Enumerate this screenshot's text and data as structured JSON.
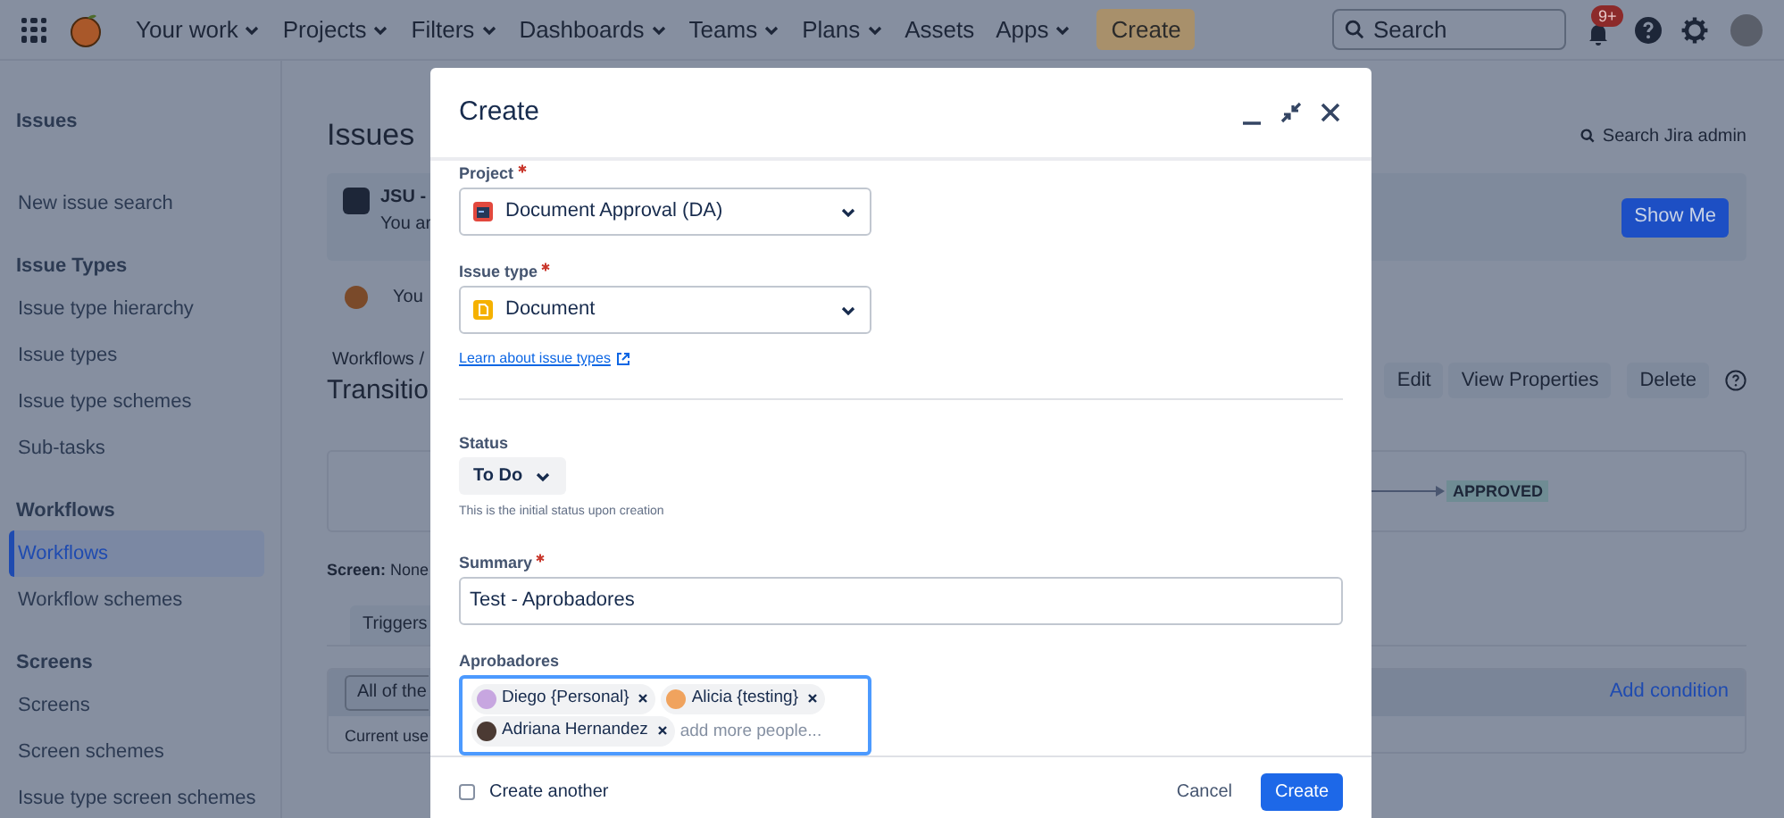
{
  "top_nav": {
    "items": [
      {
        "label": "Your work",
        "dropdown": true
      },
      {
        "label": "Projects",
        "dropdown": true
      },
      {
        "label": "Filters",
        "dropdown": true
      },
      {
        "label": "Dashboards",
        "dropdown": true
      },
      {
        "label": "Teams",
        "dropdown": true
      },
      {
        "label": "Plans",
        "dropdown": true
      },
      {
        "label": "Assets",
        "dropdown": false
      },
      {
        "label": "Apps",
        "dropdown": true
      }
    ],
    "create_button": "Create",
    "search": {
      "placeholder": "Search"
    },
    "notification_badge": "9+"
  },
  "sidebar": {
    "title": "Issues",
    "sections": [
      {
        "items": [
          {
            "label": "New issue search",
            "selected": false
          }
        ]
      },
      {
        "heading": "Issue Types",
        "items": [
          {
            "label": "Issue type hierarchy",
            "selected": false
          },
          {
            "label": "Issue types",
            "selected": false
          },
          {
            "label": "Issue type schemes",
            "selected": false
          },
          {
            "label": "Sub-tasks",
            "selected": false
          }
        ]
      },
      {
        "heading": "Workflows",
        "items": [
          {
            "label": "Workflows",
            "selected": true
          },
          {
            "label": "Workflow schemes",
            "selected": false
          }
        ]
      },
      {
        "heading": "Screens",
        "items": [
          {
            "label": "Screens",
            "selected": false
          },
          {
            "label": "Screen schemes",
            "selected": false
          },
          {
            "label": "Issue type screen schemes",
            "selected": false
          }
        ]
      }
    ]
  },
  "page": {
    "title": "Issues",
    "admin_search": "Search Jira admin",
    "banner": {
      "title": "JSU -",
      "text": "You ar",
      "button": "Show Me"
    },
    "notice": "You",
    "breadcrumb": "Workflows /",
    "heading": "Transitio",
    "actions": [
      "Edit",
      "View Properties",
      "Delete"
    ],
    "diagram": {
      "target_status": "APPROVED"
    },
    "screen": "**Screen:** None",
    "tabs": [
      {
        "label": "Triggers",
        "selected": false
      }
    ],
    "conditions": {
      "select": "All of the",
      "add_link": "Add condition",
      "rows": [
        "Current use"
      ]
    }
  },
  "modal": {
    "title": "Create",
    "fields": [
      {
        "kind": "project",
        "label": "Project",
        "required": true,
        "value": "Document Approval (DA)"
      },
      {
        "kind": "issue_type",
        "label": "Issue type",
        "required": true,
        "value": "Document",
        "help_link": "Learn about issue types"
      },
      {
        "kind": "status",
        "label": "Status",
        "required": false,
        "value": "To Do",
        "hint": "This is the initial status upon creation"
      },
      {
        "kind": "text",
        "label": "Summary",
        "required": true,
        "value": "Test - Aprobadores"
      },
      {
        "kind": "people",
        "label": "Aprobadores",
        "required": false,
        "focused": true,
        "people": [
          {
            "name": "Diego {Personal}"
          },
          {
            "name": "Alicia {testing}"
          },
          {
            "name": "Adriana Hernandez"
          }
        ],
        "placeholder": "add more people..."
      }
    ],
    "create_another": {
      "label": "Create another",
      "checked": false
    },
    "buttons": [
      {
        "kind": "subtle",
        "label": "Cancel"
      },
      {
        "kind": "primary",
        "label": "Create"
      }
    ]
  }
}
